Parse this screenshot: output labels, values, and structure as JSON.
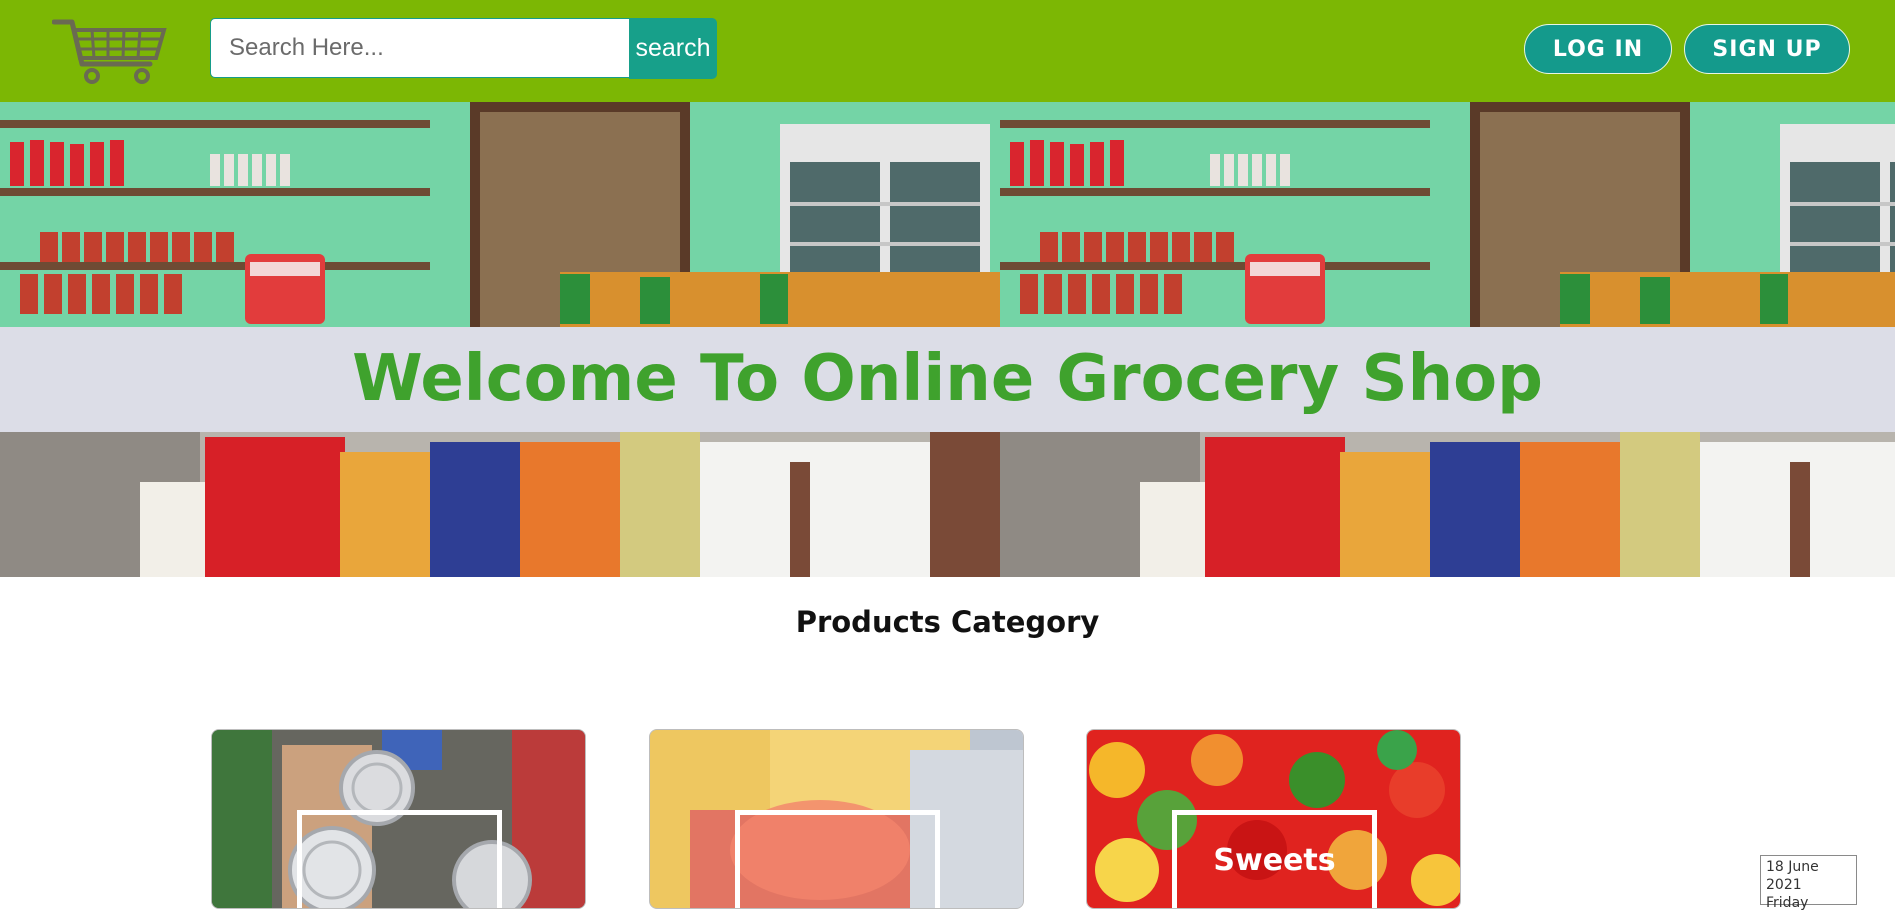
{
  "header": {
    "logo_icon": "shopping-cart-icon",
    "search": {
      "placeholder": "Search Here...",
      "value": "",
      "button_label": "search"
    },
    "login_label": "LOG IN",
    "signup_label": "SIGN UP"
  },
  "hero": {
    "title": "Welcome To Online Grocery Shop"
  },
  "products": {
    "heading": "Products Category",
    "categories": [
      {
        "label": ""
      },
      {
        "label": ""
      },
      {
        "label": "Sweets"
      }
    ]
  },
  "date_widget": {
    "date": "18 June 2021",
    "day": "Friday"
  },
  "colors": {
    "navbar": "#7cb704",
    "button_teal": "#17a08a",
    "title_green": "#3fa22d",
    "banner_strip": "#dcdde7"
  }
}
